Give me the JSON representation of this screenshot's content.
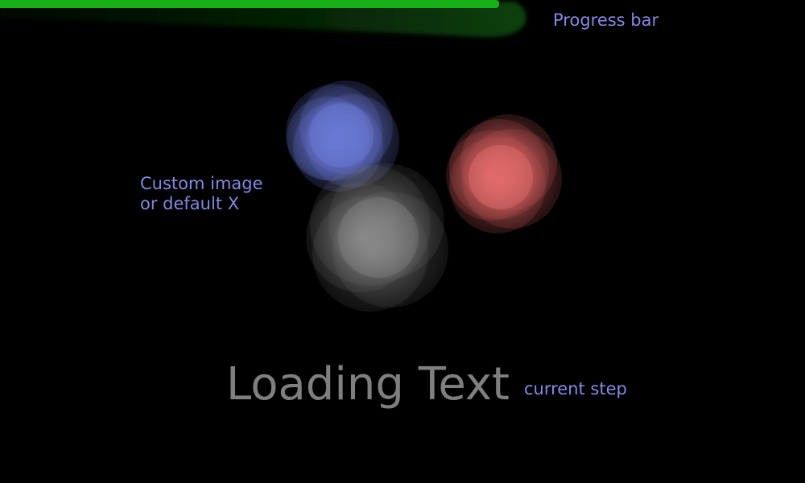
{
  "progress": {
    "fraction": 0.62,
    "color": "#17b016",
    "label": "Progress bar"
  },
  "image": {
    "label": "Custom image\nor default X",
    "colors": {
      "blue": "#6a78d8",
      "red": "#e46a6a",
      "gray": "#9a9a9a"
    }
  },
  "loading": {
    "text": "Loading Text",
    "step_label": "current step"
  },
  "colors": {
    "background": "#000000",
    "annotation": "#8389e0",
    "loading_text": "#7f7f7f"
  }
}
